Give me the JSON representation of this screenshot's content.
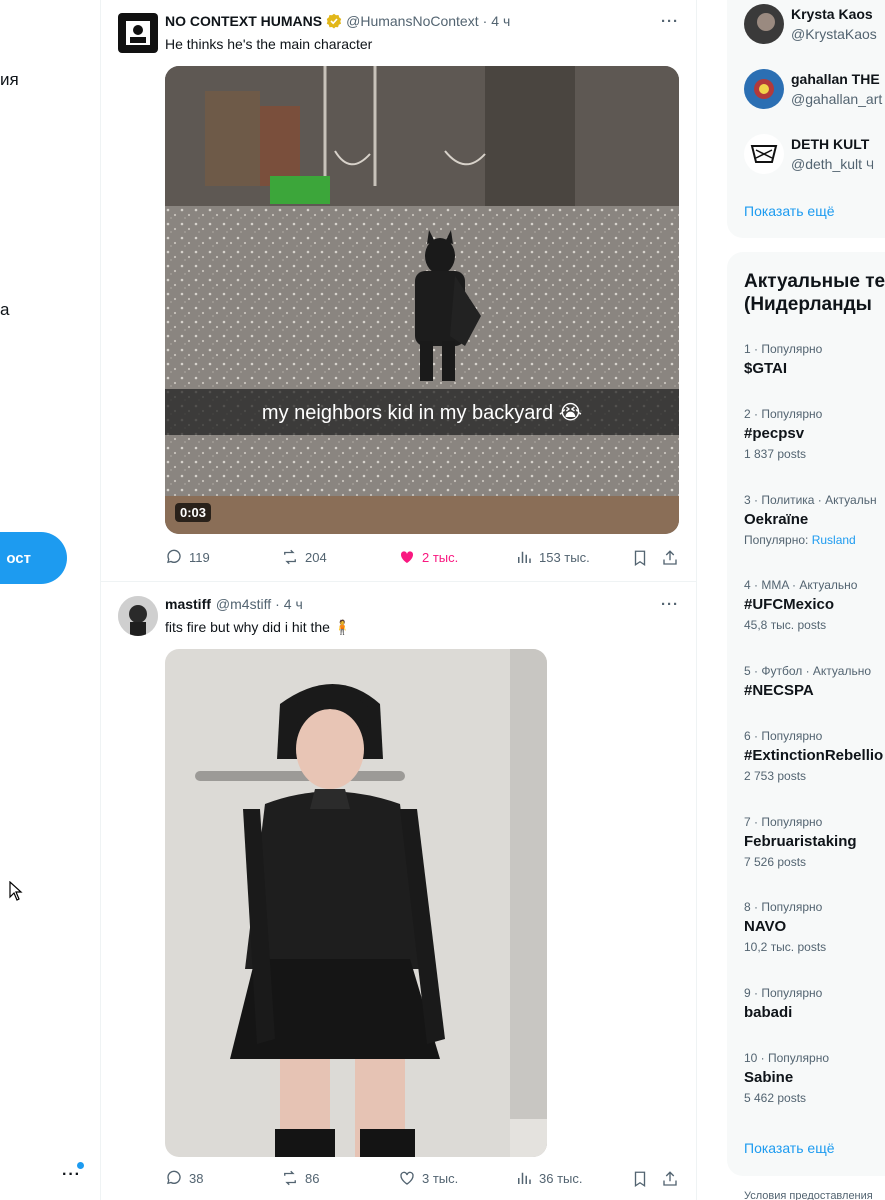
{
  "left_nav": {
    "fragment_1": "ия",
    "fragment_2": "а",
    "post_button": "ост",
    "more_label": "..."
  },
  "tweets": [
    {
      "name": "NO CONTEXT HUMANS",
      "handle": "@HumansNoContext",
      "time": "4 ч",
      "text": "He thinks he's the main character",
      "video_caption": "my neighbors kid in my backyard 😭",
      "duration": "0:03",
      "replies": "119",
      "reposts": "204",
      "likes": "2 тыс.",
      "views": "153 тыс."
    },
    {
      "name": "mastiff",
      "handle": "@m4stiff",
      "time": "4 ч",
      "text": "fits fire but why did i hit the 🧍",
      "replies": "38",
      "reposts": "86",
      "likes": "3 тыс.",
      "views": "36 тыс."
    }
  ],
  "who_to_follow": {
    "users": [
      {
        "name": "Krysta Kaos",
        "handle": "@KrystaKaos"
      },
      {
        "name": "gahallan THE",
        "handle": "@gahallan_art"
      },
      {
        "name": "DETH KULT",
        "handle": "@deth_kult",
        "suffix": "Ч"
      }
    ],
    "show_more": "Показать ещё"
  },
  "trends": {
    "title_line1": "Актуальные те",
    "title_line2": "(Нидерланды",
    "items": [
      {
        "meta": "1 · Популярно",
        "name": "$GTAI",
        "count": ""
      },
      {
        "meta": "2 · Популярно",
        "name": "#pecpsv",
        "count": "1 837 posts"
      },
      {
        "meta": "3 · Политика · Актуальн",
        "name": "Oekraïne",
        "count_prefix": "Популярно:",
        "count_link": "Rusland"
      },
      {
        "meta": "4 · MMA · Актуально",
        "name": "#UFCMexico",
        "count": "45,8 тыс. posts"
      },
      {
        "meta": "5 · Футбол · Актуально",
        "name": "#NECSPA",
        "count": ""
      },
      {
        "meta": "6 · Популярно",
        "name": "#ExtinctionRebellio",
        "count": "2 753 posts"
      },
      {
        "meta": "7 · Популярно",
        "name": "Februaristaking",
        "count": "7 526 posts"
      },
      {
        "meta": "8 · Популярно",
        "name": "NAVO",
        "count": "10,2 тыс. posts"
      },
      {
        "meta": "9 · Популярно",
        "name": "babadi",
        "count": ""
      },
      {
        "meta": "10 · Популярно",
        "name": "Sabine",
        "count": "5 462 posts"
      }
    ],
    "show_more": "Показать ещё"
  },
  "footer": "Условия предоставления",
  "colors": {
    "accent": "#1d9bf0",
    "like": "#f91880",
    "muted": "#536471"
  }
}
